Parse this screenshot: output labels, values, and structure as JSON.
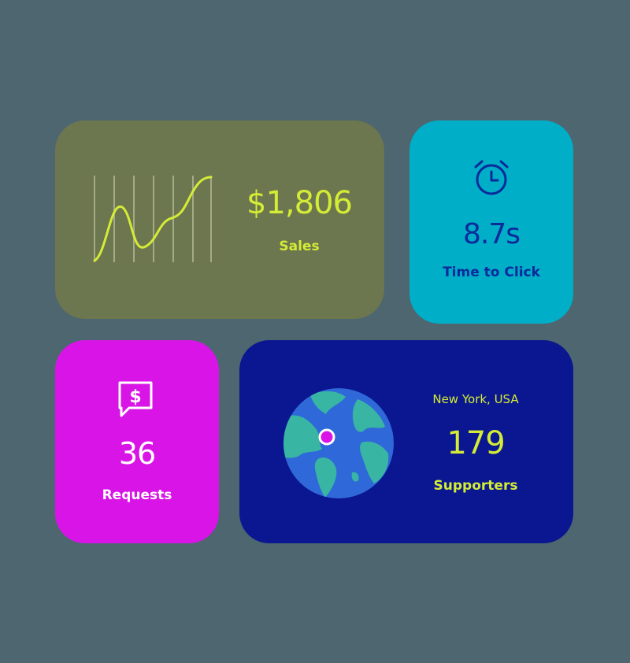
{
  "colors": {
    "background": "#4e6670",
    "sales_card": "#6c764f",
    "time_card": "#00aec8",
    "requests_card": "#d815e6",
    "supporters_card": "#0a1790",
    "accent": "#d4ec35",
    "dark_blue": "#0c2a9a",
    "pin": "#d815e6"
  },
  "sales": {
    "value": "$1,806",
    "label": "Sales",
    "icon": "sparkline-chart"
  },
  "time_to_click": {
    "value": "8.7s",
    "label": "Time to Click",
    "icon": "alarm-clock-icon"
  },
  "requests": {
    "value": "36",
    "label": "Requests",
    "icon": "dollar-chat-icon"
  },
  "supporters": {
    "location": "New York, USA",
    "value": "179",
    "label": "Supporters",
    "icon": "globe-icon"
  }
}
